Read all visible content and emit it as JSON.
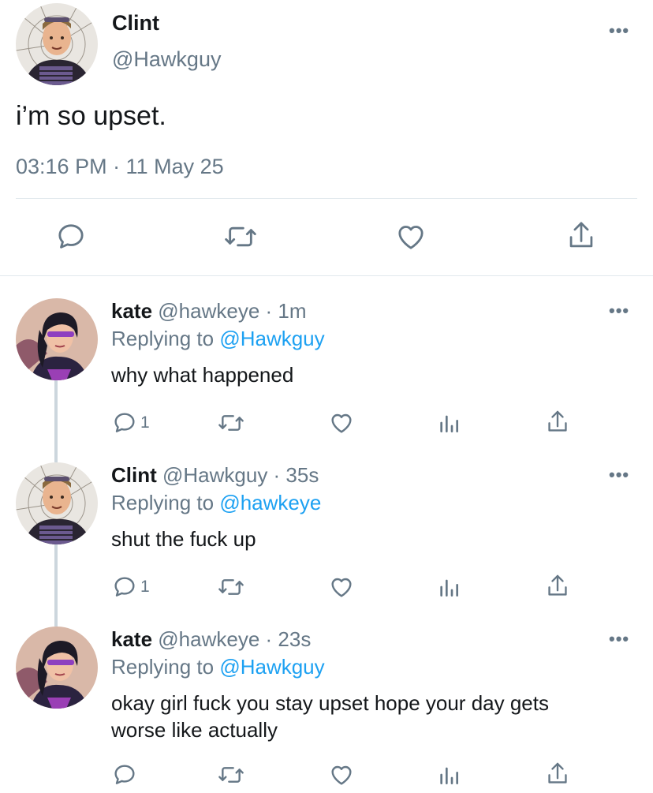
{
  "main": {
    "name": "Clint",
    "handle": "@Hawkguy",
    "text": "i’m so upset.",
    "timestamp": "03:16 PM · 11 May 25"
  },
  "replies": [
    {
      "name": "kate",
      "meta": "@hawkeye · 1m",
      "replying_label": "Replying to",
      "replying_to": "@Hawkguy",
      "text": "why what happened",
      "reply_count": "1"
    },
    {
      "name": "Clint",
      "meta": "@Hawkguy · 35s",
      "replying_label": "Replying to",
      "replying_to": "@hawkeye",
      "text": "shut the fuck up",
      "reply_count": "1"
    },
    {
      "name": "kate",
      "meta": "@hawkeye · 23s",
      "replying_label": "Replying to",
      "replying_to": "@Hawkguy",
      "text_line1": "okay girl fuck you stay upset hope your day gets",
      "text_line2": "worse like actually",
      "reply_count": ""
    }
  ],
  "colors": {
    "accent": "#1da1f2",
    "muted": "#657786",
    "divider": "#e1e8ed"
  }
}
